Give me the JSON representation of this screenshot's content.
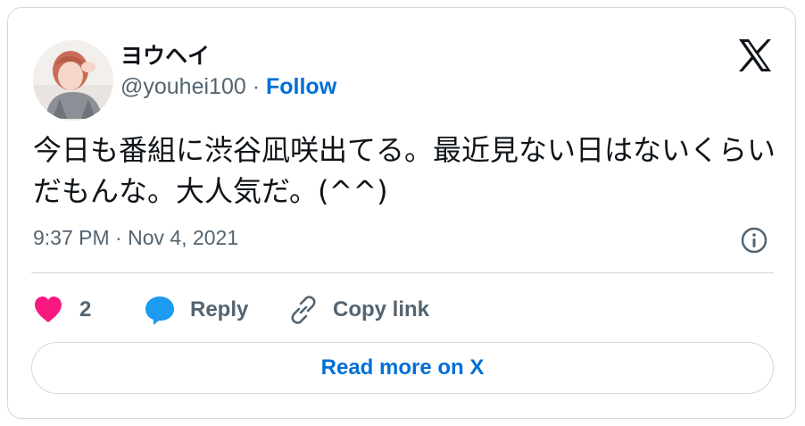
{
  "author": {
    "display_name": "ヨウヘイ",
    "handle": "@youhei100",
    "separator": " · ",
    "follow_label": "Follow"
  },
  "tweet": {
    "text": "今日も番組に渋谷凪咲出てる。最近見ない日はないくらいだもんな。大人気だ。(^^)",
    "timestamp": "9:37 PM · Nov 4, 2021"
  },
  "actions": {
    "like_count": "2",
    "reply_label": "Reply",
    "copy_link_label": "Copy link"
  },
  "read_more_label": "Read more on X",
  "colors": {
    "text": "#0f1419",
    "muted": "#536471",
    "link": "#006fd6",
    "heart": "#f91880",
    "reply_bubble": "#1d9bf0",
    "border": "#cfd9de"
  },
  "icons": [
    "x-logo-icon",
    "info-icon",
    "heart-icon",
    "reply-bubble-icon",
    "link-icon"
  ]
}
